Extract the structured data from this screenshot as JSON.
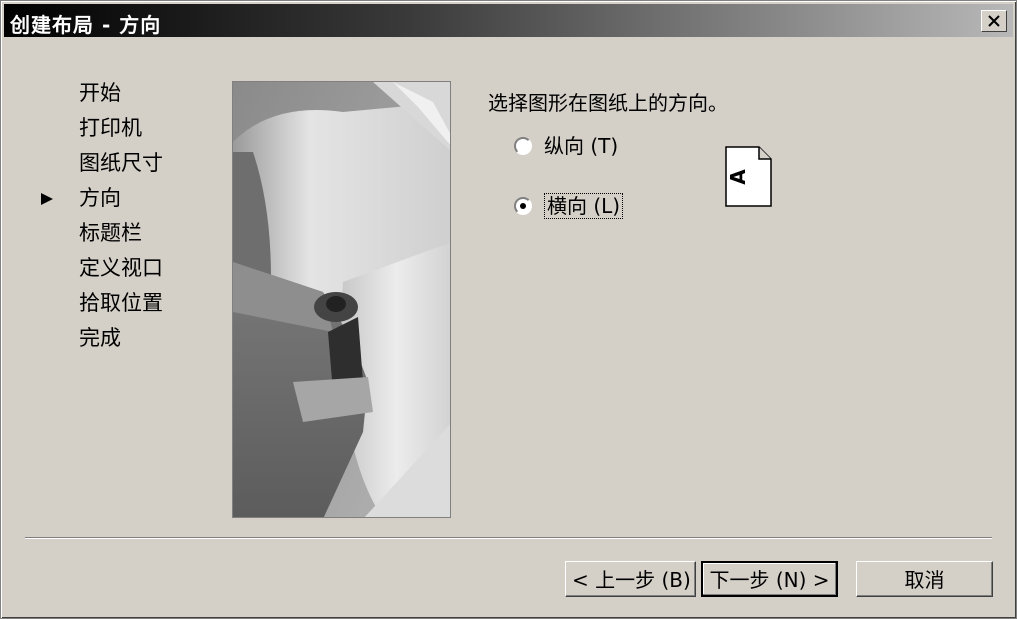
{
  "window": {
    "title": "创建布局 - 方向",
    "close_label": "×"
  },
  "steps": [
    {
      "label": "开始",
      "current": false
    },
    {
      "label": "打印机",
      "current": false
    },
    {
      "label": "图纸尺寸",
      "current": false
    },
    {
      "label": "方向",
      "current": true
    },
    {
      "label": "标题栏",
      "current": false
    },
    {
      "label": "定义视口",
      "current": false
    },
    {
      "label": "拾取位置",
      "current": false
    },
    {
      "label": "完成",
      "current": false
    }
  ],
  "main": {
    "prompt": "选择图形在图纸上的方向。",
    "options": [
      {
        "label": "纵向 (T)",
        "selected": false
      },
      {
        "label": "横向 (L)",
        "selected": true
      }
    ],
    "preview_letter": "A"
  },
  "buttons": {
    "back": "< 上一步 (B)",
    "next": "下一步 (N) >",
    "cancel": "取消"
  }
}
